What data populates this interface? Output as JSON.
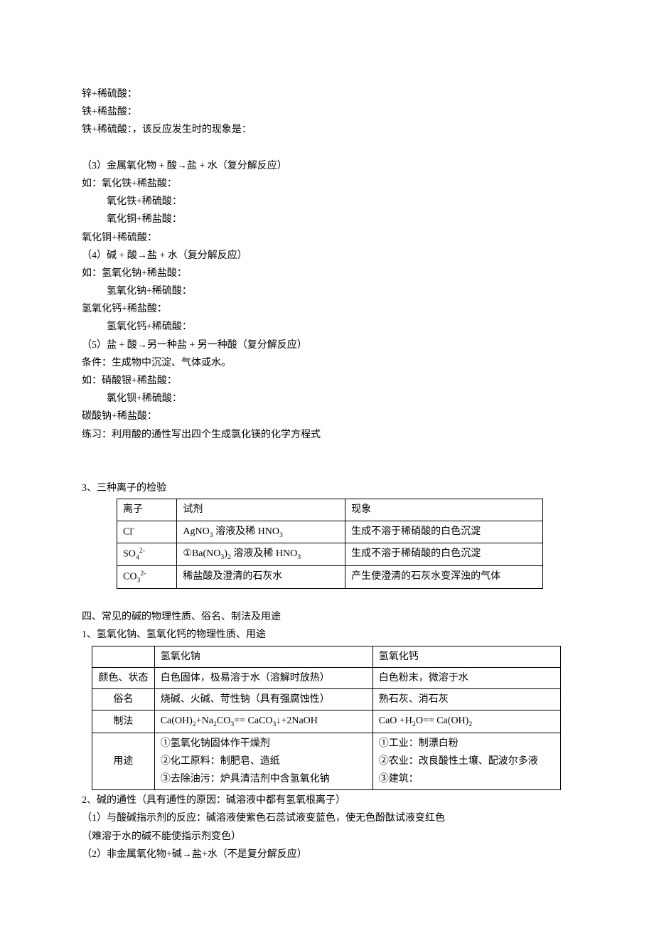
{
  "lines": {
    "l1": "锌+稀硫酸：",
    "l2": "铁+稀盐酸：",
    "l3": "铁+稀硫酸：，该反应发生时的现象是：",
    "l4": "（3）金属氧化物 + 酸→盐 + 水（复分解反应）",
    "l5": "如：氧化铁+稀盐酸：",
    "l6": "氧化铁+稀硫酸：",
    "l7": "氧化铜+稀盐酸：",
    "l8": "氧化铜+稀硫酸：",
    "l9": "（4）碱 + 酸→盐 + 水（复分解反应）",
    "l10": "如：氢氧化钠+稀盐酸：",
    "l11": "氢氧化钠+稀硫酸：",
    "l12": "氢氧化钙+稀盐酸：",
    "l13": "氢氧化钙+稀硫酸：",
    "l14": "（5）盐 + 酸→另一种盐 + 另一种酸（复分解反应）",
    "l15": "条件：生成物中沉淀、气体或水。",
    "l16": "如：硝酸银+稀盐酸：",
    "l17": "氯化钡+稀硫酸：",
    "l18": "碳酸钠+稀盐酸：",
    "l19": "练习：利用酸的通性写出四个生成氯化镁的化学方程式",
    "s3": "3、三种离子的检验",
    "s4": "四、常见的碱的物理性质、俗名、制法及用途",
    "s4_1": "1、氢氧化钠、氢氧化钙的物理性质、用途",
    "s4_2": "2、碱的通性（具有通性的原因：碱溶液中都有氢氧根离子）",
    "s4_2_1": "（1）与酸碱指示剂的反应：碱溶液使紫色石蕊试液变蓝色，使无色酚酞试液变红色",
    "s4_2_1b": "（难溶于水的碱不能使指示剂变色）",
    "s4_2_2": "（2）非金属氧化物+碱→盐+水（不是复分解反应）"
  },
  "ionTable": {
    "h1": "离子",
    "h2": "试剂",
    "h3": "现象",
    "r1c1_a": "Cl",
    "r1c1_b": "-",
    "r1c2_a": "AgNO",
    "r1c2_b": "3",
    "r1c2_c": " 溶液及稀 HNO",
    "r1c2_d": "3",
    "r1c3": "生成不溶于稀硝酸的白色沉淀",
    "r2c1_a": "SO",
    "r2c1_b": "4",
    "r2c1_c": "2-",
    "r2c2_a": "①Ba(NO",
    "r2c2_b": "3",
    "r2c2_c": ")",
    "r2c2_d": "2",
    "r2c2_e": " 溶液及稀 HNO",
    "r2c2_f": "3",
    "r2c3": "生成不溶于稀硝酸的白色沉淀",
    "r3c1_a": "CO",
    "r3c1_b": "3",
    "r3c1_c": "2-",
    "r3c2": "稀盐酸及澄清的石灰水",
    "r3c3": "产生使澄清的石灰水变浑浊的气体"
  },
  "baseTable": {
    "h2": "氢氧化钠",
    "h3": "氢氧化钙",
    "r1c1": "颜色、状态",
    "r1c2": "白色固体，极易溶于水（溶解时放热）",
    "r1c3": "白色粉末，微溶于水",
    "r2c1": "俗名",
    "r2c2": "烧碱、火碱、苛性钠（具有强腐蚀性）",
    "r2c3": "熟石灰、消石灰",
    "r3c1": "制法",
    "r3c2_a": "Ca(OH)",
    "r3c2_b": "2",
    "r3c2_c": "+Na",
    "r3c2_d": "2",
    "r3c2_e": "CO",
    "r3c2_f": "3",
    "r3c2_g": "== CaCO",
    "r3c2_h": "3",
    "r3c2_i": "↓+2NaOH",
    "r3c3_a": "CaO +H",
    "r3c3_b": "2",
    "r3c3_c": "O== Ca(OH)",
    "r3c3_d": "2",
    "r4c1": "用途",
    "r4c2_1": "①氢氧化钠固体作干燥剂",
    "r4c2_2": "②化工原料：制肥皂、造纸",
    "r4c2_3": "③去除油污：炉具清洁剂中含氢氧化钠",
    "r4c3_1": "①工业：制漂白粉",
    "r4c3_2": "②农业：改良酸性土壤、配波尔多液",
    "r4c3_3": "③建筑："
  }
}
